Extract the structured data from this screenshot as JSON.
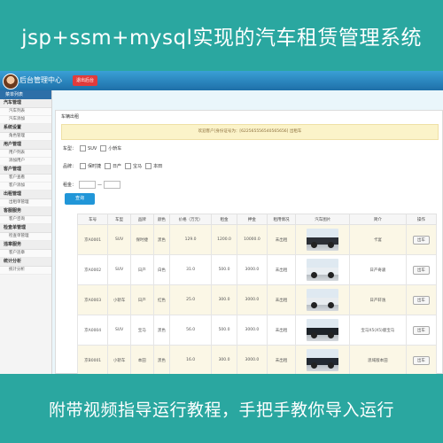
{
  "banner": {
    "top": "jsp+ssm+mysql实现的汽车租赁管理系统",
    "bottom": "附带视频指导运行教程，手把手教你导入运行"
  },
  "header": {
    "title": "后台管理中心",
    "logout": "退出后台"
  },
  "sidebar": {
    "head": "菜单列表",
    "groups": [
      {
        "title": "汽车管理",
        "items": [
          "汽车列表",
          "汽车添加"
        ]
      },
      {
        "title": "系统设置",
        "items": [
          "角色管理"
        ]
      },
      {
        "title": "用户管理",
        "items": [
          "用户列表",
          "添加用户"
        ]
      },
      {
        "title": "客户管理",
        "items": [
          "客户查看",
          "客户添加"
        ]
      },
      {
        "title": "出租管理",
        "items": [
          "出租单管理"
        ]
      },
      {
        "title": "客服服务",
        "items": [
          "客户咨询"
        ]
      },
      {
        "title": "检查单管理",
        "items": [
          "检查单管理"
        ]
      },
      {
        "title": "违章服务",
        "items": [
          "客户违章"
        ]
      },
      {
        "title": "统计分析",
        "items": [
          "统计分析"
        ]
      }
    ]
  },
  "content": {
    "panel_title": "车辆出租",
    "notice": "欢迎客户[身份证号为：[622565556540565656] 出租车",
    "filters": {
      "type_label": "车型：",
      "types": [
        "SUV",
        "小轿车"
      ],
      "brand_label": "品牌：",
      "brands": [
        "保时捷",
        "日产",
        "宝马",
        "本田"
      ],
      "price_label": "租金：",
      "price_dash": "—"
    },
    "query_button": "查询"
  },
  "table": {
    "headers": [
      "车号",
      "车型",
      "品牌",
      "颜色",
      "价格（万元）",
      "租金",
      "押金",
      "租用情况",
      "汽车图片",
      "简介",
      "操作"
    ],
    "rows": [
      [
        "京A0001",
        "SUV",
        "保时捷",
        "黑色",
        "129.0",
        "1200.0",
        "10000.0",
        "未出租",
        "",
        "卡宴",
        "出车"
      ],
      [
        "京A0002",
        "SUV",
        "日产",
        "白色",
        "31.0",
        "500.0",
        "3000.0",
        "未出租",
        "",
        "日产奇骏",
        "出车"
      ],
      [
        "京A0003",
        "小轿车",
        "日产",
        "红色",
        "25.0",
        "300.0",
        "3000.0",
        "未出租",
        "",
        "日产轩逸",
        "出车"
      ],
      [
        "京A0004",
        "SUV",
        "宝马",
        "黑色",
        "56.0",
        "500.0",
        "3000.0",
        "未出租",
        "",
        "宝马X5(X5)版宝马",
        "出车"
      ],
      [
        "京B0001",
        "小轿车",
        "本田",
        "黑色",
        "16.0",
        "300.0",
        "3000.0",
        "未出租",
        "",
        "思域版本田",
        "出车"
      ]
    ],
    "car_colors": [
      "#2b2f36",
      "#e9eef2",
      "#e8ecef",
      "#1d2228",
      "#222831"
    ]
  }
}
